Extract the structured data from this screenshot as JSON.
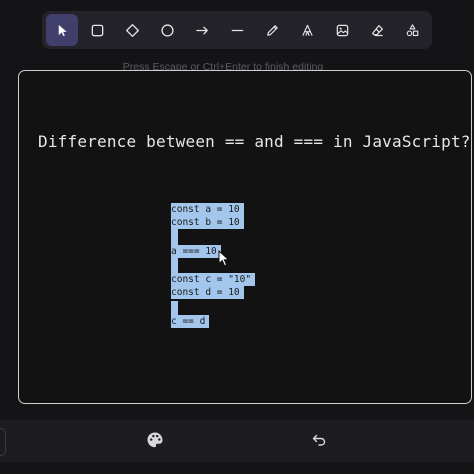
{
  "toolbar": {
    "tools": [
      {
        "icon": "selection-arrow-icon",
        "active": true
      },
      {
        "icon": "rectangle-icon"
      },
      {
        "icon": "diamond-icon"
      },
      {
        "icon": "ellipse-icon"
      },
      {
        "icon": "arrow-icon"
      },
      {
        "icon": "line-icon"
      },
      {
        "icon": "pencil-icon"
      },
      {
        "icon": "text-icon",
        "glyph": "A"
      },
      {
        "icon": "image-icon"
      },
      {
        "icon": "eraser-icon"
      },
      {
        "icon": "shapes-library-icon"
      }
    ]
  },
  "hint": "Press Escape or Ctrl+Enter to finish editing",
  "canvas": {
    "heading": "Difference between == and === in JavaScript?",
    "code": {
      "line1": "const a = 10",
      "line2": "const b = 10",
      "line3": "a === 10",
      "line4": "const c = \"10\"",
      "line5": "const d = 10",
      "line6": "c == d"
    }
  },
  "footer": {
    "icons": [
      "palette-icon",
      "undo-icon"
    ]
  },
  "colors": {
    "background": "#141416",
    "toolbar": "#232329",
    "active_tool": "#403e6a",
    "selection_highlight": "#a3c6ec"
  }
}
